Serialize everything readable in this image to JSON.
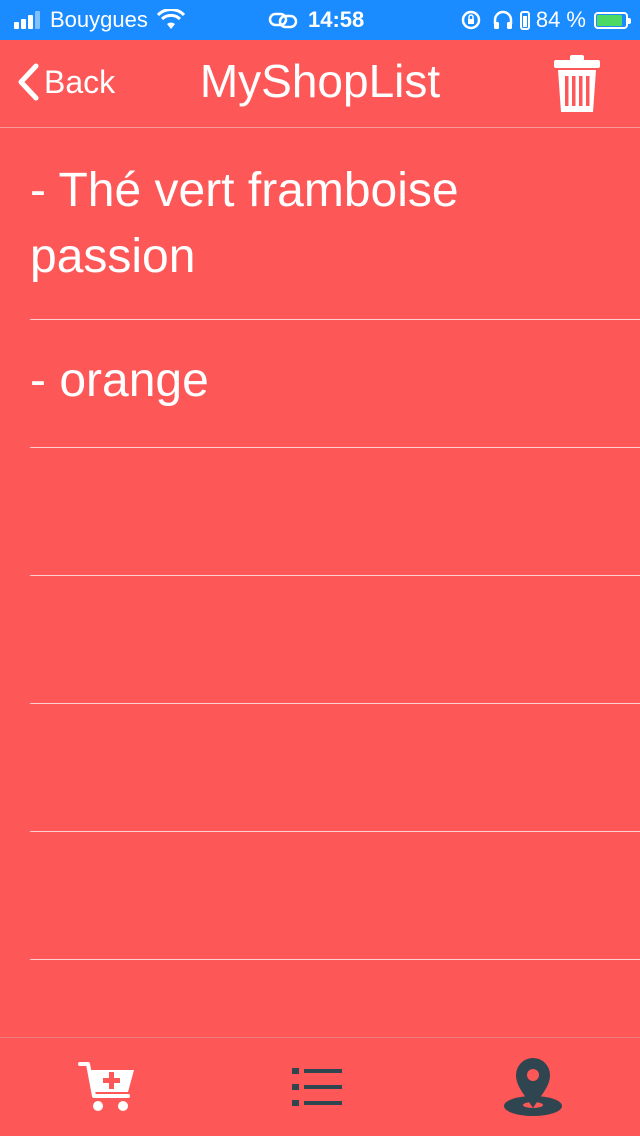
{
  "status_bar": {
    "carrier": "Bouygues",
    "time": "14:58",
    "battery_percent": "84 %",
    "battery_level": 0.84,
    "icons": [
      "signal-icon",
      "wifi-icon",
      "link-icon",
      "rotation-lock-icon",
      "headphones-icon",
      "battery-icon"
    ]
  },
  "nav": {
    "back_label": "Back",
    "title": "MyShopList",
    "trash_icon": "trash-icon"
  },
  "items": [
    {
      "text": "- Thé vert framboise passion"
    },
    {
      "text": "- orange"
    }
  ],
  "tab_bar": {
    "tabs": [
      {
        "icon": "cart-add-icon",
        "color": "#FFFFFF"
      },
      {
        "icon": "list-icon",
        "color": "#2F4550"
      },
      {
        "icon": "map-pin-icon",
        "color": "#2F4550"
      }
    ]
  },
  "colors": {
    "background": "#FE5757",
    "status_bar": "#1A8CFF",
    "text": "#FFFFFF",
    "dark_icon": "#2F4550"
  }
}
